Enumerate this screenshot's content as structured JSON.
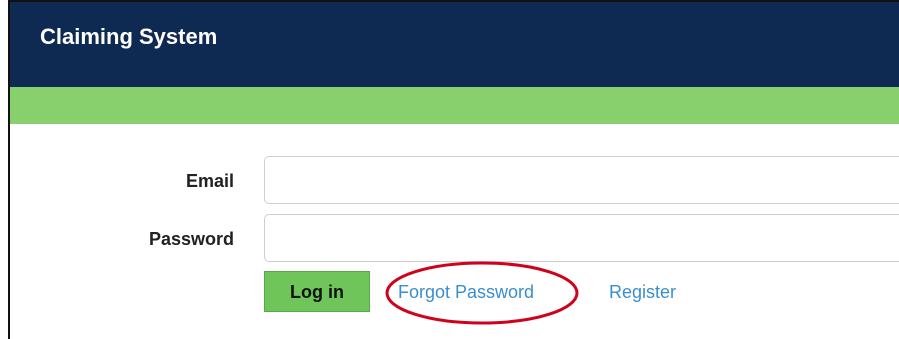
{
  "header": {
    "title": "Claiming System"
  },
  "form": {
    "email_label": "Email",
    "email_value": "",
    "password_label": "Password",
    "password_value": ""
  },
  "actions": {
    "login_label": "Log in",
    "forgot_password_label": "Forgot Password",
    "register_label": "Register"
  },
  "colors": {
    "header_background": "#0f2a52",
    "accent_bar": "#88cf6e",
    "login_button": "#6fc45a",
    "link": "#3a8ed0",
    "highlight_annotation": "#d0021b"
  }
}
